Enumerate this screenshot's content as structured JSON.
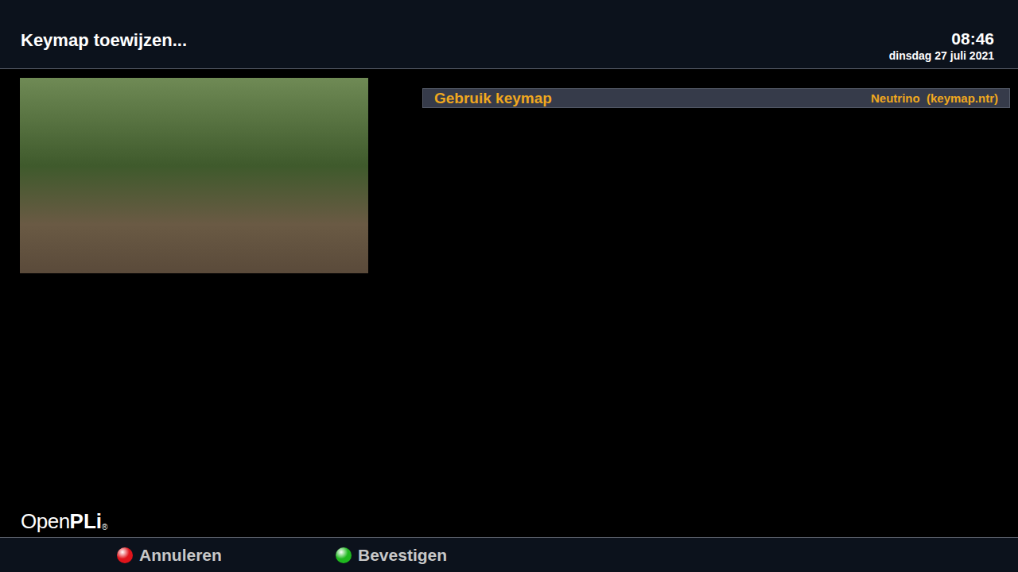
{
  "header": {
    "title": "Keymap toewijzen...",
    "time": "08:46",
    "date": "dinsdag 27 juli 2021"
  },
  "menu": [
    {
      "label": "Gebruik keymap",
      "value": "Neutrino  (keymap.ntr)",
      "selected": true
    }
  ],
  "logo": {
    "light": "Open",
    "bold": "PLi",
    "mark": "®"
  },
  "buttons": [
    {
      "label": "Annuleren",
      "color": "#e0141b"
    },
    {
      "label": "Bevestigen",
      "color": "#1fb81f"
    }
  ]
}
